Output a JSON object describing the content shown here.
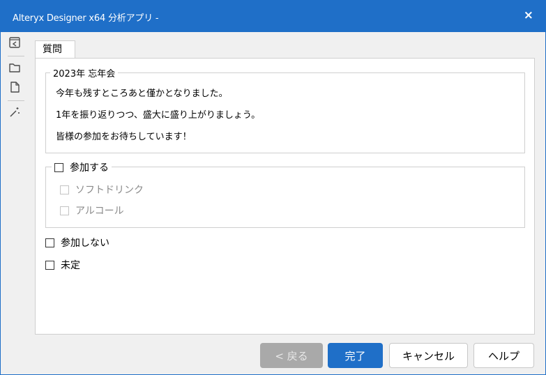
{
  "window": {
    "title": "Alteryx Designer x64 分析アプリ -",
    "close_glyph": "×"
  },
  "toolbar": [
    {
      "icon": "panel-collapse-icon"
    },
    {
      "icon": "folder-icon"
    },
    {
      "icon": "file-icon"
    },
    {
      "icon": "magic-wand-icon"
    }
  ],
  "tab": {
    "label": "質問"
  },
  "message_group": {
    "legend": "2023年 忘年会",
    "lines": [
      "今年も残すところあと僅かとなりました。",
      "1年を振り返りつつ、盛大に盛り上がりましょう。",
      "皆様の参加をお待ちしています！"
    ]
  },
  "options": {
    "attend": {
      "label": "参加する",
      "checked": false
    },
    "sub_options": [
      {
        "label": "ソフトドリンク",
        "checked": false,
        "enabled": false
      },
      {
        "label": "アルコール",
        "checked": false,
        "enabled": false
      }
    ],
    "not_attend": {
      "label": "参加しない",
      "checked": false
    },
    "undecided": {
      "label": "未定",
      "checked": false
    }
  },
  "buttons": {
    "back": "< 戻る",
    "done": "完了",
    "cancel": "キャンセル",
    "help": "ヘルプ"
  },
  "colors": {
    "accent": "#1f6fc8",
    "disabled_button": "#a9a9a9"
  }
}
